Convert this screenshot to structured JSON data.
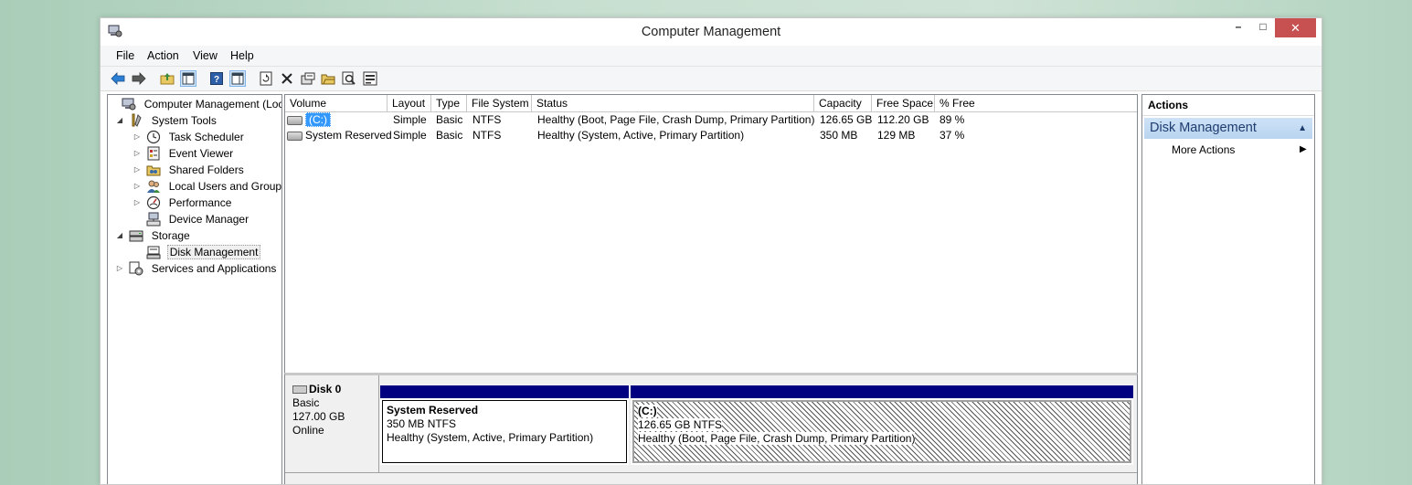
{
  "window": {
    "title": "Computer Management",
    "controls": {
      "minimize": "–",
      "maximize": "□",
      "close": "✕"
    }
  },
  "menu": [
    "File",
    "Action",
    "View",
    "Help"
  ],
  "toolbar_icons": [
    "back-arrow-icon",
    "forward-arrow-icon",
    "up-folder-icon",
    "show-hide-console-tree-icon",
    "help-icon",
    "show-hide-action-pane-icon",
    "refresh-icon",
    "delete-icon",
    "properties-icon",
    "open-icon",
    "find-icon",
    "settings-icon"
  ],
  "tree": {
    "items": [
      {
        "label": "Computer Management (Local",
        "level": 0,
        "expander": "",
        "icon": "computer-management-icon"
      },
      {
        "label": "System Tools",
        "level": 1,
        "expander": "◢",
        "icon": "system-tools-icon"
      },
      {
        "label": "Task Scheduler",
        "level": 2,
        "expander": "▷",
        "icon": "clock-icon"
      },
      {
        "label": "Event Viewer",
        "level": 2,
        "expander": "▷",
        "icon": "event-viewer-icon"
      },
      {
        "label": "Shared Folders",
        "level": 2,
        "expander": "▷",
        "icon": "shared-folders-icon"
      },
      {
        "label": "Local Users and Groups",
        "level": 2,
        "expander": "▷",
        "icon": "users-icon"
      },
      {
        "label": "Performance",
        "level": 2,
        "expander": "▷",
        "icon": "performance-icon"
      },
      {
        "label": "Device Manager",
        "level": 2,
        "expander": "",
        "icon": "device-manager-icon"
      },
      {
        "label": "Storage",
        "level": 1,
        "expander": "◢",
        "icon": "storage-icon"
      },
      {
        "label": "Disk Management",
        "level": 2,
        "expander": "",
        "icon": "disk-management-icon",
        "selected": true
      },
      {
        "label": "Services and Applications",
        "level": 1,
        "expander": "▷",
        "icon": "services-icon"
      }
    ]
  },
  "volumes": {
    "columns": [
      "Volume",
      "Layout",
      "Type",
      "File System",
      "Status",
      "Capacity",
      "Free Space",
      "% Free"
    ],
    "rows": [
      [
        "(C:)",
        "Simple",
        "Basic",
        "NTFS",
        "Healthy (Boot, Page File, Crash Dump, Primary Partition)",
        "126.65 GB",
        "112.20 GB",
        "89 %"
      ],
      [
        "System Reserved",
        "Simple",
        "Basic",
        "NTFS",
        "Healthy (System, Active, Primary Partition)",
        "350 MB",
        "129 MB",
        "37 %"
      ]
    ]
  },
  "disk": {
    "name": "Disk 0",
    "type": "Basic",
    "size": "127.00 GB",
    "status": "Online",
    "partitions": [
      {
        "name": "System Reserved",
        "size": "350 MB NTFS",
        "status": "Healthy (System, Active, Primary Partition)"
      },
      {
        "name": "(C:)",
        "size": "126.65 GB NTFS",
        "status": "Healthy (Boot, Page File, Crash Dump, Primary Partition)"
      }
    ]
  },
  "actions": {
    "title": "Actions",
    "section": "Disk Management",
    "items": [
      "More Actions"
    ]
  },
  "colors": {
    "selection": "#3399ff",
    "partition_bar": "#000080",
    "close_button": "#c75050",
    "actions_header": "#cde2f7"
  }
}
